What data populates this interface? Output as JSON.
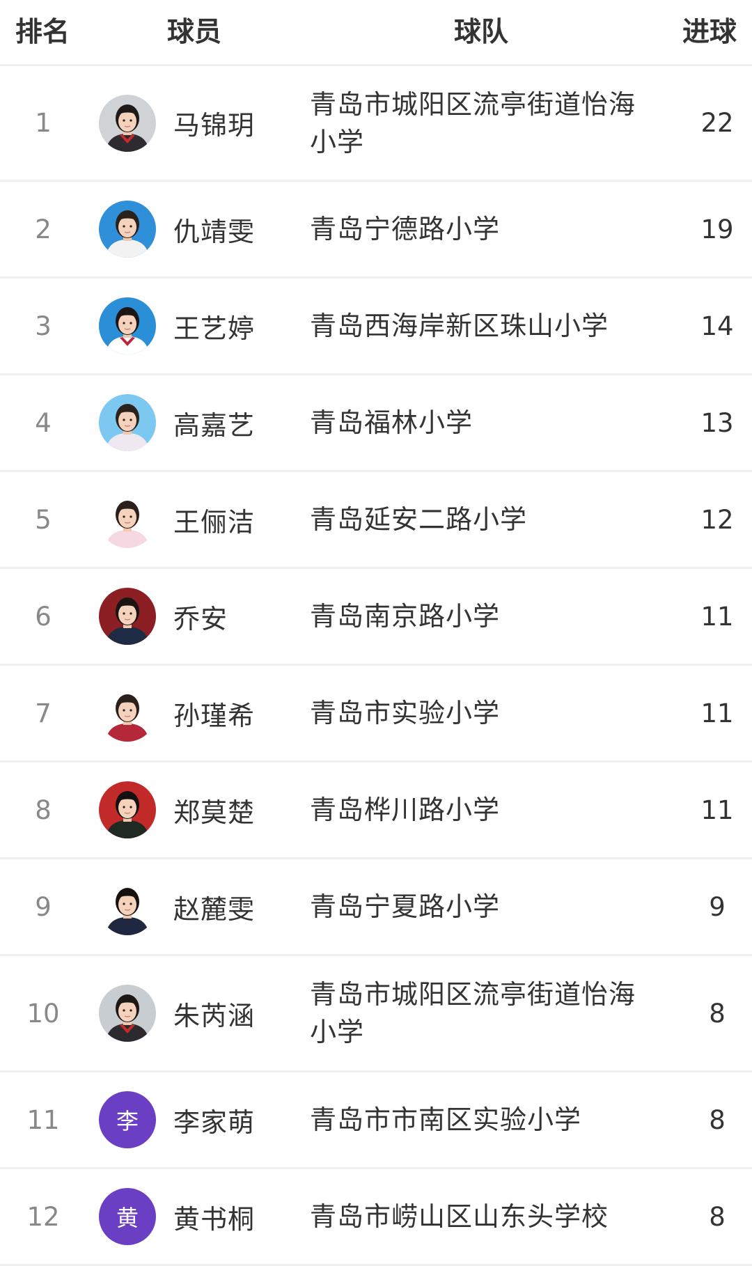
{
  "header": {
    "rank": "排名",
    "player": "球员",
    "team": "球队",
    "goals": "进球"
  },
  "rows": [
    {
      "rank": "1",
      "name": "马锦玥",
      "team": "青岛市城阳区流亭街道怡海小学",
      "goals": "22",
      "avatar": "photo",
      "bg": "#cfd3d6",
      "shirt": "#2d2b2f",
      "scarf": "#c92a2a",
      "hair": "#1e1a18"
    },
    {
      "rank": "2",
      "name": "仇靖雯",
      "team": "青岛宁德路小学",
      "goals": "19",
      "avatar": "photo",
      "bg": "#2f8fd8",
      "shirt": "#f2f2f2",
      "scarf": "",
      "hair": "#2a211c"
    },
    {
      "rank": "3",
      "name": "王艺婷",
      "team": "青岛西海岸新区珠山小学",
      "goals": "14",
      "avatar": "photo",
      "bg": "#2a8fd6",
      "shirt": "#ffffff",
      "scarf": "#c0263a",
      "hair": "#1c1614"
    },
    {
      "rank": "4",
      "name": "高嘉艺",
      "team": "青岛福林小学",
      "goals": "13",
      "avatar": "photo",
      "bg": "#7cc8f0",
      "shirt": "#efe8f0",
      "scarf": "",
      "hair": "#2b211d"
    },
    {
      "rank": "5",
      "name": "王俪洁",
      "team": "青岛延安二路小学",
      "goals": "12",
      "avatar": "photo",
      "bg": "#ffffff",
      "shirt": "#f6d8e2",
      "scarf": "",
      "hair": "#2a1f1a"
    },
    {
      "rank": "6",
      "name": "乔安",
      "team": "青岛南京路小学",
      "goals": "11",
      "avatar": "photo",
      "bg": "#8c1f24",
      "shirt": "#1f2a44",
      "scarf": "",
      "hair": "#1a1412"
    },
    {
      "rank": "7",
      "name": "孙瑾希",
      "team": "青岛市实验小学",
      "goals": "11",
      "avatar": "photo",
      "bg": "#ffffff",
      "shirt": "#b5283a",
      "scarf": "",
      "hair": "#2b201b"
    },
    {
      "rank": "8",
      "name": "郑莫楚",
      "team": "青岛桦川路小学",
      "goals": "11",
      "avatar": "photo",
      "bg": "#c22a2a",
      "shirt": "#1e2a22",
      "scarf": "",
      "hair": "#151110"
    },
    {
      "rank": "9",
      "name": "赵麓雯",
      "team": "青岛宁夏路小学",
      "goals": "9",
      "avatar": "photo",
      "bg": "#ffffff",
      "shirt": "#1f2840",
      "scarf": "",
      "hair": "#161210"
    },
    {
      "rank": "10",
      "name": "朱芮涵",
      "team": "青岛市城阳区流亭街道怡海小学",
      "goals": "8",
      "avatar": "photo",
      "bg": "#c8cdd1",
      "shirt": "#2c2a2e",
      "scarf": "#c92a2a",
      "hair": "#1d1816"
    },
    {
      "rank": "11",
      "name": "李家萌",
      "team": "青岛市市南区实验小学",
      "goals": "8",
      "avatar": "letter",
      "letter": "李",
      "bg": "#6a3fc4"
    },
    {
      "rank": "12",
      "name": "黄书桐",
      "team": "青岛市崂山区山东头学校",
      "goals": "8",
      "avatar": "letter",
      "letter": "黄",
      "bg": "#6a3fc4"
    }
  ]
}
